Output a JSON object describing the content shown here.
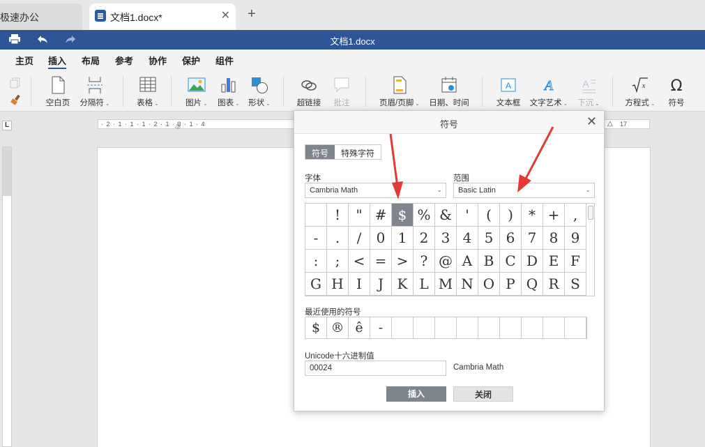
{
  "tabs": [
    {
      "label": "极速办公"
    },
    {
      "label": "文档1.docx*"
    }
  ],
  "titlebar": {
    "title": "文档1.docx"
  },
  "menu": [
    "主页",
    "插入",
    "布局",
    "参考",
    "协作",
    "保护",
    "组件"
  ],
  "ribbon": {
    "blank_page": "空白页",
    "separator": "分隔符",
    "table": "表格",
    "picture": "图片",
    "chart": "图表",
    "shape": "形状",
    "hyperlink": "超链接",
    "comment": "批注",
    "header_footer": "页眉/页脚",
    "date_time": "日期、时间",
    "textbox": "文本框",
    "wordart": "文字艺术",
    "dropcap": "下沉",
    "equation": "方程式",
    "symbol": "符号"
  },
  "ruler": {
    "left_marks": "· 2 · 1 · 1 · 1 · 2 · 1 · 3 · 1 · 4",
    "right_mark": "17"
  },
  "dialog": {
    "title": "符号",
    "tab_symbol": "符号",
    "tab_special": "特殊字符",
    "font_label": "字体",
    "font_value": "Cambria Math",
    "range_label": "范围",
    "range_value": "Basic Latin",
    "symbols": [
      " ",
      "!",
      "\"",
      "#",
      "$",
      "%",
      "&",
      "'",
      "(",
      ")",
      "*",
      "+",
      ",",
      "-",
      ".",
      "/",
      "0",
      "1",
      "2",
      "3",
      "4",
      "5",
      "6",
      "7",
      "8",
      "9",
      ":",
      ";",
      "<",
      "=",
      ">",
      "?",
      "@",
      "A",
      "B",
      "C",
      "D",
      "E",
      "F",
      "G",
      "H",
      "I",
      "J",
      "K",
      "L",
      "M",
      "N",
      "O",
      "P",
      "Q",
      "R",
      "S"
    ],
    "selected_symbol": "$",
    "recent_label": "最近使用的符号",
    "recent": [
      "$",
      "®",
      "ê",
      "-",
      "",
      "",
      "",
      "",
      "",
      "",
      "",
      "",
      ""
    ],
    "unicode_label": "Unicode十六进制值",
    "unicode_value": "00024",
    "unicode_font": "Cambria Math",
    "insert_button": "插入",
    "close_button": "关闭"
  },
  "colors": {
    "brand": "#2e5596",
    "selected": "#7f858c",
    "arrow": "#e53935"
  }
}
